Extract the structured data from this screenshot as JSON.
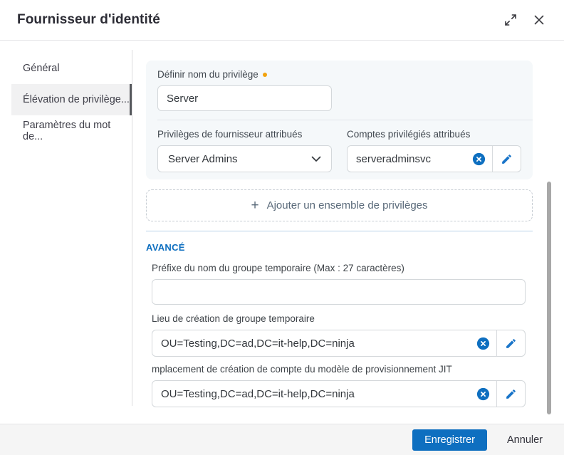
{
  "dialog": {
    "title": "Fournisseur d'identité"
  },
  "sidebar": {
    "items": [
      {
        "label": "Général",
        "selected": false
      },
      {
        "label": "Élévation de privilège...",
        "selected": true
      },
      {
        "label": "Paramètres du mot de...",
        "selected": false
      }
    ]
  },
  "form": {
    "privilege_name": {
      "label": "Définir nom du privilège",
      "required": true,
      "value": "Server"
    },
    "provider_privileges": {
      "label": "Privilèges de fournisseur attribués",
      "selected_option": "Server Admins"
    },
    "privileged_accounts": {
      "label": "Comptes privilégiés attribués",
      "value": "serveradminsvc"
    },
    "add_privilege_set": {
      "plus": "+",
      "label": "Ajouter un ensemble de privilèges"
    },
    "advanced": {
      "section_label": "AVANCÉ",
      "group_prefix": {
        "label": "Préfixe du nom du groupe temporaire (Max : 27 caractères)",
        "value": ""
      },
      "group_location": {
        "label": "Lieu de création de groupe temporaire",
        "value": "OU=Testing,DC=ad,DC=it-help,DC=ninja"
      },
      "jit_location": {
        "label": "mplacement de création de compte du modèle de provisionnement JIT",
        "value": "OU=Testing,DC=ad,DC=it-help,DC=ninja"
      }
    }
  },
  "footer": {
    "save_label": "Enregistrer",
    "cancel_label": "Annuler"
  },
  "icons": {
    "expand": "diagonal-expand-arrows",
    "close": "x",
    "required": "orange-dot",
    "dropdown": "chevron-down",
    "clear": "x-in-filled-circle",
    "edit": "pencil",
    "add": "plus"
  },
  "colors": {
    "accent_blue": "#0e6fc0",
    "required_orange": "#f2a20d",
    "card_bg": "#f5f8fa",
    "footer_bg": "#f5f5f5",
    "divider_blue": "#b9d2e8",
    "scrollbar_gray": "#a8a8a8"
  }
}
